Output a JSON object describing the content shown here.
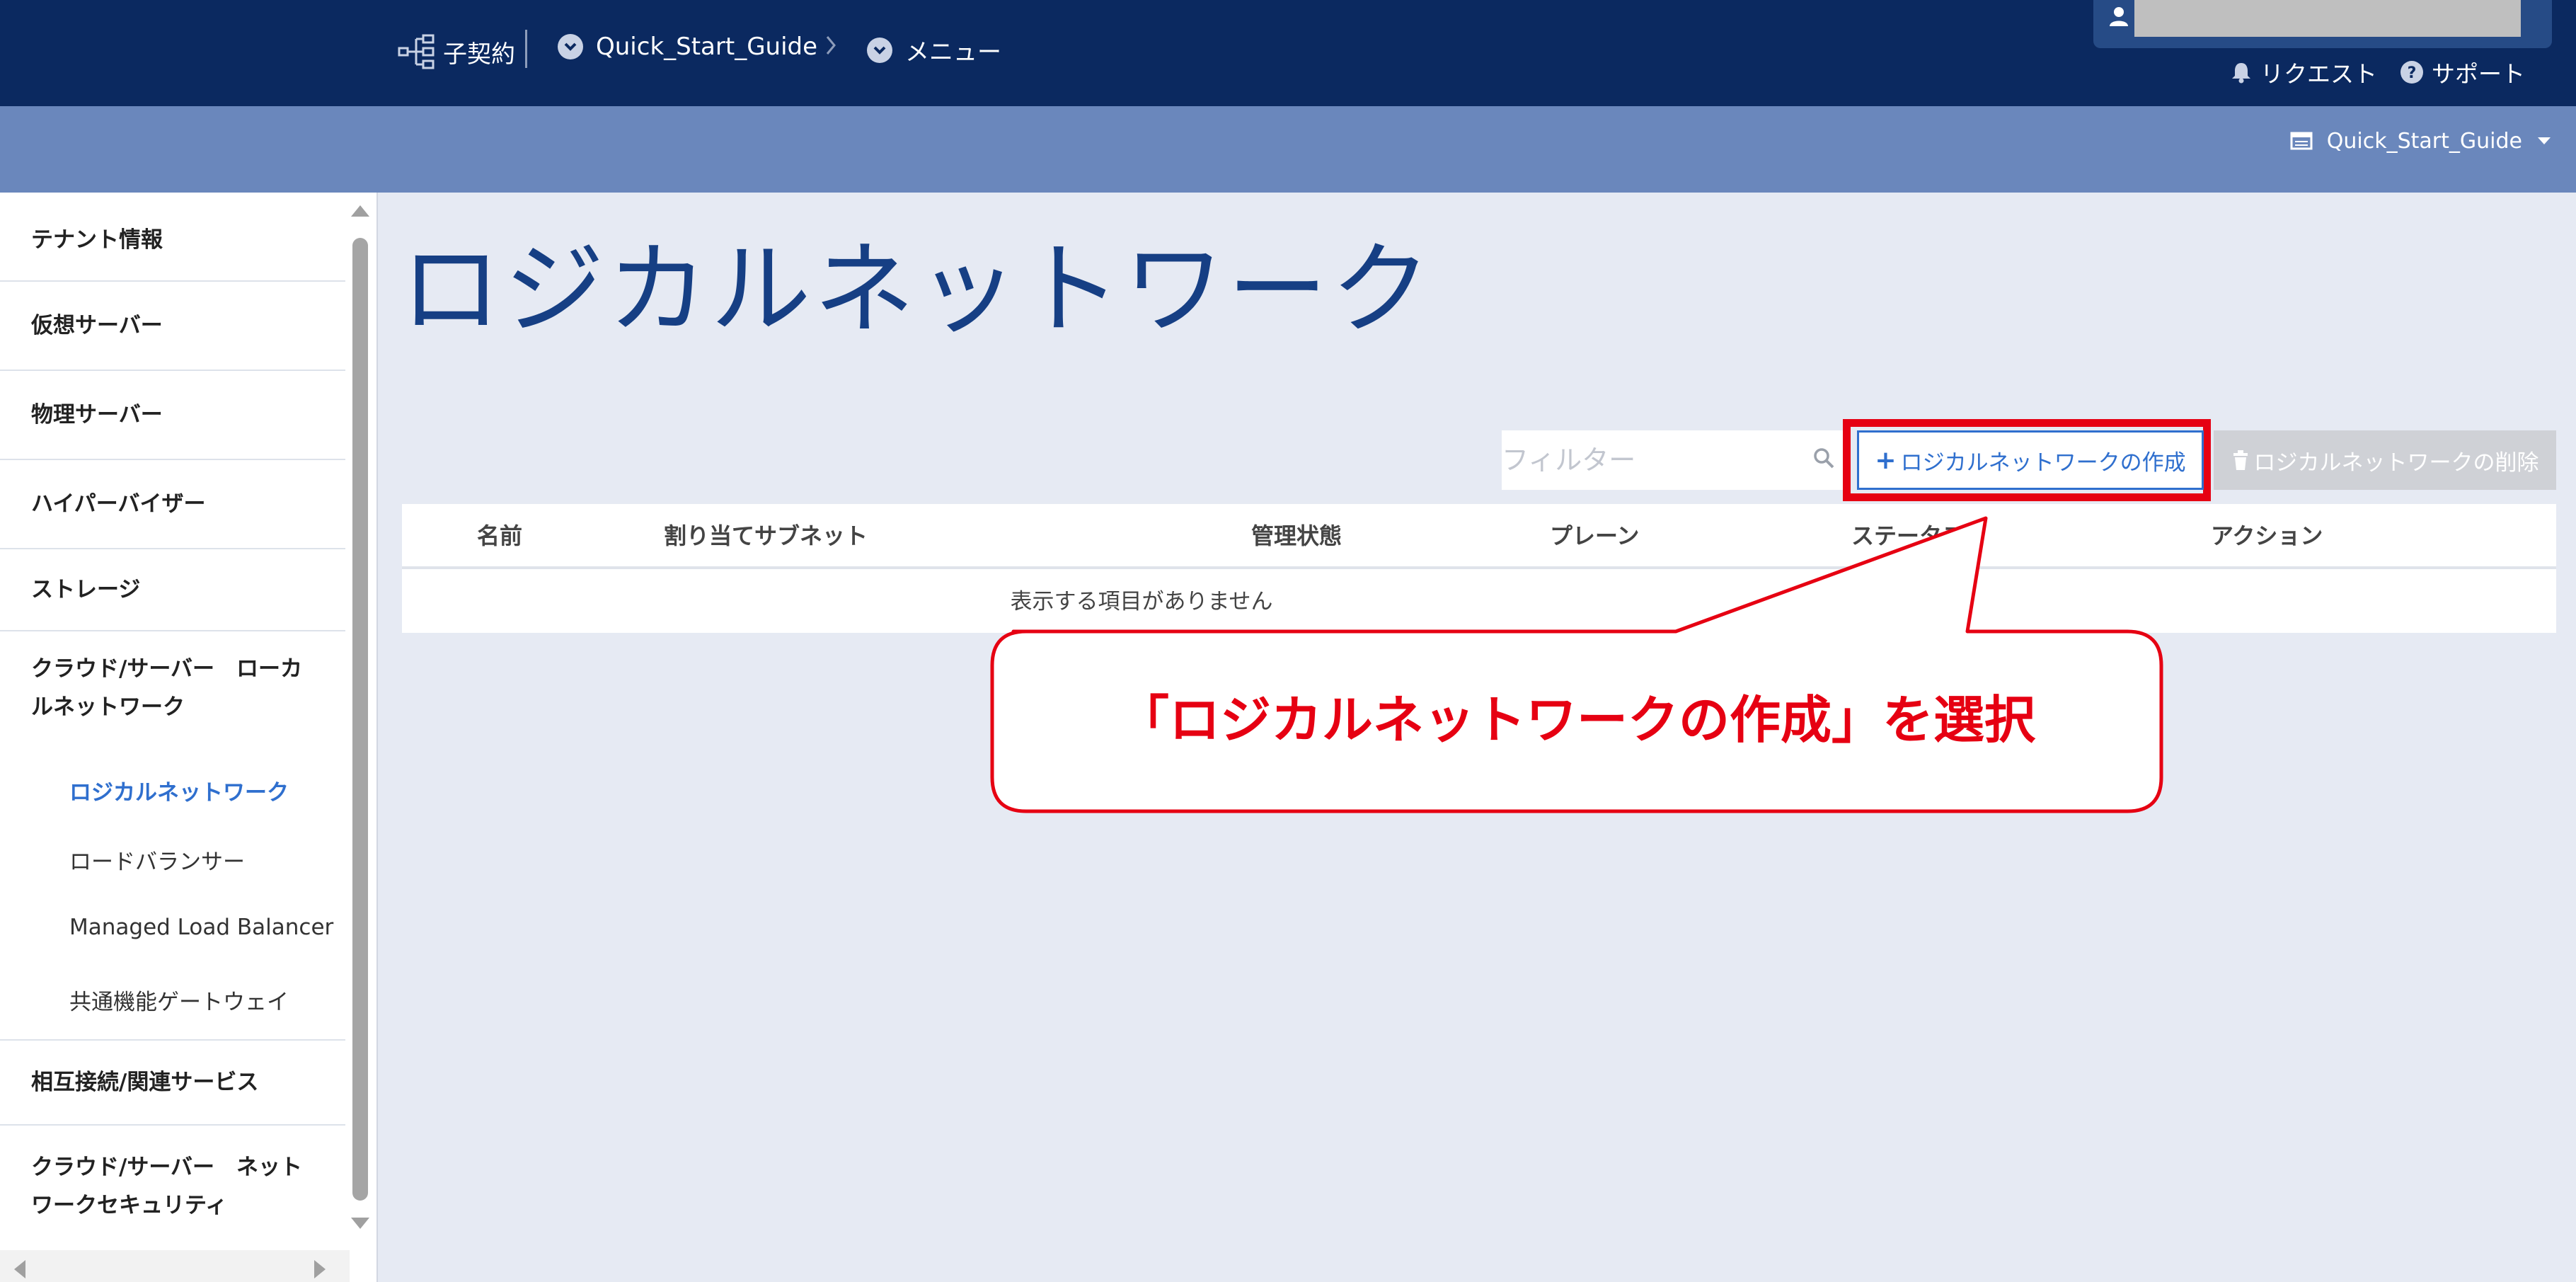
{
  "header": {
    "contract_label": "子契約",
    "project_label": "Quick_Start_Guide",
    "menu_label": "メニュー",
    "request_label": "リクエスト",
    "support_label": "サポート",
    "tenant_label": "Quick_Start_Guide"
  },
  "sidebar": {
    "items": [
      {
        "label": "テナント情報"
      },
      {
        "label": "仮想サーバー"
      },
      {
        "label": "物理サーバー"
      },
      {
        "label": "ハイパーバイザー"
      },
      {
        "label": "ストレージ"
      },
      {
        "label": "クラウド/サーバー　ローカ",
        "label2": "ルネットワーク"
      },
      {
        "label": "相互接続/関連サービス"
      },
      {
        "label": "クラウド/サーバー　ネット",
        "label2": "ワークセキュリティ"
      }
    ],
    "subitems": [
      {
        "label": "ロジカルネットワーク"
      },
      {
        "label": "ロードバランサー"
      },
      {
        "label": "Managed Load Balancer"
      },
      {
        "label": "共通機能ゲートウェイ"
      }
    ]
  },
  "main": {
    "title": "ロジカルネットワーク",
    "filter_placeholder": "フィルター",
    "create_label": "ロジカルネットワークの作成",
    "delete_label": "ロジカルネットワークの削除",
    "columns": [
      "名前",
      "割り当てサブネット",
      "管理状態",
      "プレーン",
      "ステータス",
      "アクション"
    ],
    "empty_message": "表示する項目がありません"
  },
  "annotation": {
    "callout_text": "「ロジカルネットワークの作成」を選択"
  },
  "colors": {
    "header_bg": "#0b2960",
    "subbar_bg": "#6a87bc",
    "title": "#163f84",
    "accent": "#2f6fce",
    "highlight": "#e60012"
  }
}
